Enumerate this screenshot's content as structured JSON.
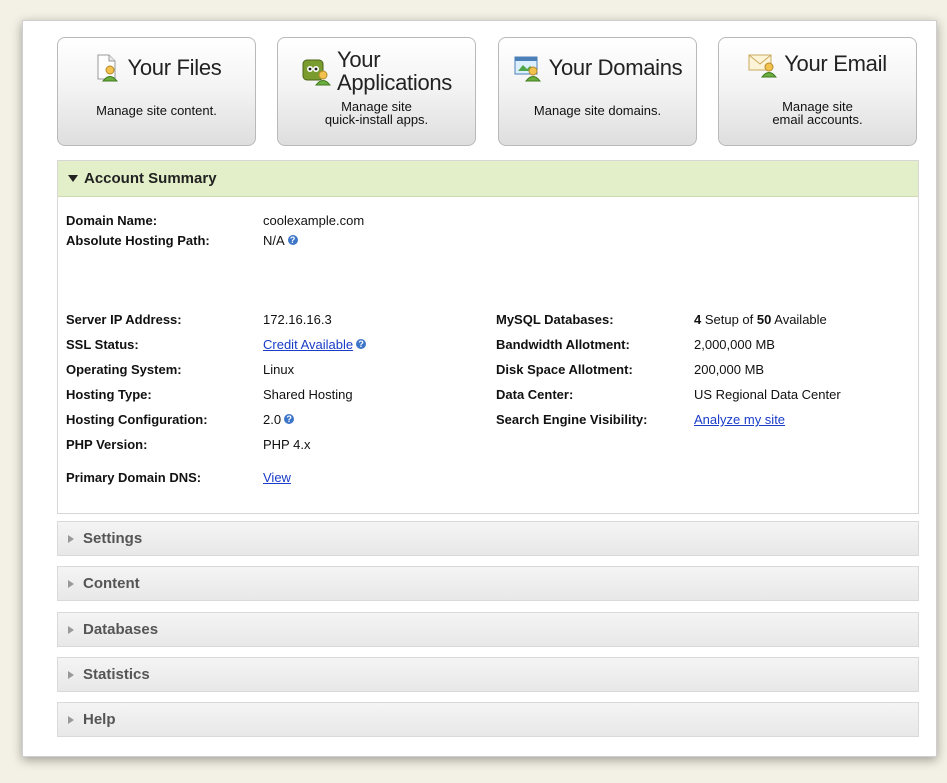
{
  "tiles": [
    {
      "title": "Your Files",
      "desc": "Manage site content.",
      "icon": "file-user-icon"
    },
    {
      "title": "Your\nApplications",
      "desc": "Manage site\nquick-install apps.",
      "icon": "applications-icon"
    },
    {
      "title": "Your Domains",
      "desc": "Manage site domains.",
      "icon": "domains-icon"
    },
    {
      "title": "Your Email",
      "desc": "Manage site\nemail accounts.",
      "icon": "email-icon"
    }
  ],
  "summary": {
    "title": "Account Summary",
    "domain_name": {
      "label": "Domain Name:",
      "value": "coolexample.com"
    },
    "hosting_path": {
      "label": "Absolute Hosting Path:",
      "value": "N/A"
    },
    "server_ip": {
      "label": "Server IP Address:",
      "value": "172.16.16.3"
    },
    "ssl": {
      "label": "SSL Status:",
      "value": "Credit Available"
    },
    "os": {
      "label": "Operating System:",
      "value": "Linux"
    },
    "hosting_type": {
      "label": "Hosting Type:",
      "value": "Shared Hosting"
    },
    "hosting_config": {
      "label": "Hosting Configuration:",
      "value": "2.0"
    },
    "php": {
      "label": "PHP Version:",
      "value": "PHP 4.x"
    },
    "dns": {
      "label": "Primary Domain DNS:",
      "value": "View"
    },
    "mysql": {
      "label": "MySQL Databases:",
      "setup": "4",
      "setup_text": " Setup of ",
      "available": "50",
      "available_text": " Available"
    },
    "bandwidth": {
      "label": "Bandwidth Allotment:",
      "value": "2,000,000 MB"
    },
    "disk": {
      "label": "Disk Space Allotment:",
      "value": "200,000 MB"
    },
    "datacenter": {
      "label": "Data Center:",
      "value": "US Regional Data Center"
    },
    "seo": {
      "label": "Search Engine Visibility:",
      "value": "Analyze my site"
    }
  },
  "help_icon_glyph": "?",
  "sections": [
    "Settings",
    "Content",
    "Databases",
    "Statistics",
    "Help"
  ],
  "colors": {
    "summary_header_bg": "#e3efc8",
    "link": "#1a3cc8",
    "help_icon": "#3d76c8"
  }
}
